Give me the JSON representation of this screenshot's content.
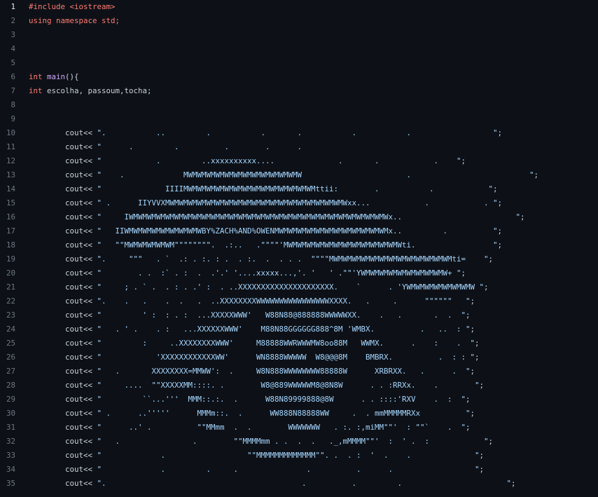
{
  "editor": {
    "colors": {
      "background": "#0d1117",
      "line_number": "#6e7681",
      "keyword": "#ff7b72",
      "string": "#a5d6ff",
      "function": "#d2a8ff",
      "text": "#c9d1d9"
    },
    "lines": [
      {
        "n": "1",
        "active": true,
        "tokens": [
          {
            "t": "#include <iostream>",
            "c": "pp"
          }
        ]
      },
      {
        "n": "2",
        "tokens": [
          {
            "t": "using namespace std;",
            "c": "kw"
          }
        ]
      },
      {
        "n": "3",
        "tokens": []
      },
      {
        "n": "4",
        "tokens": []
      },
      {
        "n": "5",
        "tokens": []
      },
      {
        "n": "6",
        "tokens": [
          {
            "t": "int ",
            "c": "kw"
          },
          {
            "t": "main",
            "c": "fn"
          },
          {
            "t": "(){",
            "c": "plain"
          }
        ]
      },
      {
        "n": "7",
        "tokens": [
          {
            "t": "int ",
            "c": "kw"
          },
          {
            "t": "escolha, passoum,tocha;",
            "c": "plain"
          }
        ]
      },
      {
        "n": "8",
        "tokens": []
      },
      {
        "n": "9",
        "tokens": []
      },
      {
        "n": "10",
        "tokens": [
          {
            "t": "        cout<< ",
            "c": "plain"
          },
          {
            "t": "\".           ..         .           .       .           .           .                  \"",
            "c": "str"
          },
          {
            "t": ";",
            "c": "plain"
          }
        ]
      },
      {
        "n": "11",
        "tokens": [
          {
            "t": "        cout<< ",
            "c": "plain"
          },
          {
            "t": "\"      .         .          .        .      .",
            "c": "str"
          }
        ]
      },
      {
        "n": "12",
        "tokens": [
          {
            "t": "        cout<< ",
            "c": "plain"
          },
          {
            "t": "\"            .         ..xxxxxxxxxx....              .       .            .    \"",
            "c": "str"
          },
          {
            "t": ";",
            "c": "plain"
          }
        ]
      },
      {
        "n": "13",
        "tokens": [
          {
            "t": "        cout<< ",
            "c": "plain"
          },
          {
            "t": "\"    .             MWMWMWMWMWMWMWMWMWMWMWMWMW                       .                          \"",
            "c": "str"
          },
          {
            "t": ";",
            "c": "plain"
          }
        ]
      },
      {
        "n": "14",
        "tokens": [
          {
            "t": "        cout<< ",
            "c": "plain"
          },
          {
            "t": "\"              IIIIMWMWMWMWMWMWMWMWMWMWMWMWMWMWMttii:        .           .            \"",
            "c": "str"
          },
          {
            "t": ";",
            "c": "plain"
          }
        ]
      },
      {
        "n": "15",
        "tokens": [
          {
            "t": "        cout<< ",
            "c": "plain"
          },
          {
            "t": "\" .      IIYVVXMWMWMWMWMWMWMWMWMWMWMWMWMWMWMWMWMWMWMWMWxx...            .            . \"",
            "c": "str"
          },
          {
            "t": ";",
            "c": "plain"
          }
        ]
      },
      {
        "n": "16",
        "tokens": [
          {
            "t": "        cout<< ",
            "c": "plain"
          },
          {
            "t": "\"     IWMWMWMWMWMWMWMWMWMWMWMWMWMWMWMWMWMWMWMWMWMWMWMWMWMWMWMWMWx..                         \"",
            "c": "str"
          },
          {
            "t": ";",
            "c": "plain"
          }
        ]
      },
      {
        "n": "17",
        "tokens": [
          {
            "t": "        cout<< ",
            "c": "plain"
          },
          {
            "t": "\"   IIWMWMWMWMWMWMWMWMWBY%ZACH%AND%OWENMWMWMWMWMWMWMWMWMWMWMWMWMx..         .          \"",
            "c": "str"
          },
          {
            "t": ";",
            "c": "plain"
          }
        ]
      },
      {
        "n": "18",
        "tokens": [
          {
            "t": "        cout<< ",
            "c": "plain"
          },
          {
            "t": "\"   \"\"MWMWMWMWMWM\"\"\"\"\"\"\"\".  .:..   .\"\"\"\"'MWMWMWMWMWMWMWMWMWMWMWMWMWti.                 \"",
            "c": "str"
          },
          {
            "t": ";",
            "c": "plain"
          }
        ]
      },
      {
        "n": "19",
        "tokens": [
          {
            "t": "        cout<< ",
            "c": "plain"
          },
          {
            "t": "\".     \"\"\"   . `  .: . :. : .  . :.  .  . . .  \"\"\"\"MWMWMWMWMWMWMWMWMWMWMWMWMWMti=    \"",
            "c": "str"
          },
          {
            "t": ";",
            "c": "plain"
          }
        ]
      },
      {
        "n": "20",
        "tokens": [
          {
            "t": "        cout<< ",
            "c": "plain"
          },
          {
            "t": "\"        . .  :` . :  .  .'.' '....xxxxx...,'. '   ' .\"\"'YWMWMWMWMWMWMWMWMWMW+ \"",
            "c": "str"
          },
          {
            "t": ";",
            "c": "plain"
          }
        ]
      },
      {
        "n": "21",
        "tokens": [
          {
            "t": "        cout<< ",
            "c": "plain"
          },
          {
            "t": "\"     ; . ` .  . : . .' :  . ..XXXXXXXXXXXXXXXXXXXXX.    `      . 'YWMWMWMWMWMWMWMW \"",
            "c": "str"
          },
          {
            "t": ";",
            "c": "plain"
          }
        ]
      },
      {
        "n": "22",
        "tokens": [
          {
            "t": "        cout<< ",
            "c": "plain"
          },
          {
            "t": "\".    .   .    .  .   .  ..XXXXXXXXWWWWWWWWWWWWWWWWXXXX.   .     .      \"\"\"\"\"\"   \"",
            "c": "str"
          },
          {
            "t": ";",
            "c": "plain"
          }
        ]
      },
      {
        "n": "23",
        "tokens": [
          {
            "t": "        cout<< ",
            "c": "plain"
          },
          {
            "t": "\"         ' :  : . :  ...XXXXXWWW'   W88N88@888888WWWWWXX.    .   .       .  .  \"",
            "c": "str"
          },
          {
            "t": ";",
            "c": "plain"
          }
        ]
      },
      {
        "n": "24",
        "tokens": [
          {
            "t": "        cout<< ",
            "c": "plain"
          },
          {
            "t": "\"   . ' .    . :   ...XXXXXXWWW'    M88N88GGGGGG888^8M 'WMBX.          .   ..  : \"",
            "c": "str"
          },
          {
            "t": ";",
            "c": "plain"
          }
        ]
      },
      {
        "n": "25",
        "tokens": [
          {
            "t": "        cout<< ",
            "c": "plain"
          },
          {
            "t": "\"         :     ..XXXXXXXXWWW'     M88888WWRWWWMW8oo88M   WWMX.      .    :    .  \"",
            "c": "str"
          },
          {
            "t": ";",
            "c": "plain"
          }
        ]
      },
      {
        "n": "26",
        "tokens": [
          {
            "t": "        cout<< ",
            "c": "plain"
          },
          {
            "t": "\"            'XXXXXXXXXXXXWW'      WN8888WWWWW  W8@@@8M    BMBRX.          .  : : \"",
            "c": "str"
          },
          {
            "t": ";",
            "c": "plain"
          }
        ]
      },
      {
        "n": "27",
        "tokens": [
          {
            "t": "        cout<< ",
            "c": "plain"
          },
          {
            "t": "\"   .       XXXXXXXX=MMWW':  .     W8N888WWWWWWWW88888W      XRBRXX.   .      .  \"",
            "c": "str"
          },
          {
            "t": ";",
            "c": "plain"
          }
        ]
      },
      {
        "n": "28",
        "tokens": [
          {
            "t": "        cout<< ",
            "c": "plain"
          },
          {
            "t": "\"     ....  \"\"XXXXXMM::::. .        W8@889WWWWWM8@8N8W      . . :RRXx.    .        \"",
            "c": "str"
          },
          {
            "t": ";",
            "c": "plain"
          }
        ]
      },
      {
        "n": "29",
        "tokens": [
          {
            "t": "        cout<< ",
            "c": "plain"
          },
          {
            "t": "\"         ``...'''  MMM::.:.  .      W88N89999888@8W      . . ::::'RXV    .  :  \"",
            "c": "str"
          },
          {
            "t": ";",
            "c": "plain"
          }
        ]
      },
      {
        "n": "30",
        "tokens": [
          {
            "t": "        cout<< ",
            "c": "plain"
          },
          {
            "t": "\" .      ..'''''      MMMm::.  .      WW888N88888WW     .  . mmMMMMMRXx          \"",
            "c": "str"
          },
          {
            "t": ";",
            "c": "plain"
          }
        ]
      },
      {
        "n": "31",
        "tokens": [
          {
            "t": "        cout<< ",
            "c": "plain"
          },
          {
            "t": "\"      ..' .          \"\"MMmm  .  .        WWWWWWW   . :. :,miMM\"\"'  : \"\"`    .  \"",
            "c": "str"
          },
          {
            "t": ";",
            "c": "plain"
          }
        ]
      },
      {
        "n": "32",
        "tokens": [
          {
            "t": "        cout<< ",
            "c": "plain"
          },
          {
            "t": "\"   .                .        \"\"MMMMmm . .  .  .   ._,mMMMM\"\"'  :  ' .  :            \"",
            "c": "str"
          },
          {
            "t": ";",
            "c": "plain"
          }
        ]
      },
      {
        "n": "33",
        "tokens": [
          {
            "t": "        cout<< ",
            "c": "plain"
          },
          {
            "t": "\"             .                  \"\"MMMMMMMMMMMMM\"\". .  . :  '  .    .              \"",
            "c": "str"
          },
          {
            "t": ";",
            "c": "plain"
          }
        ]
      },
      {
        "n": "34",
        "tokens": [
          {
            "t": "        cout<< ",
            "c": "plain"
          },
          {
            "t": "\"             .         .     .               .          .      .                  \"",
            "c": "str"
          },
          {
            "t": ";",
            "c": "plain"
          }
        ]
      },
      {
        "n": "35",
        "tokens": [
          {
            "t": "        cout<< ",
            "c": "plain"
          },
          {
            "t": "\".                                           .          .         .                       \"",
            "c": "str"
          },
          {
            "t": ";",
            "c": "plain"
          }
        ]
      }
    ]
  }
}
